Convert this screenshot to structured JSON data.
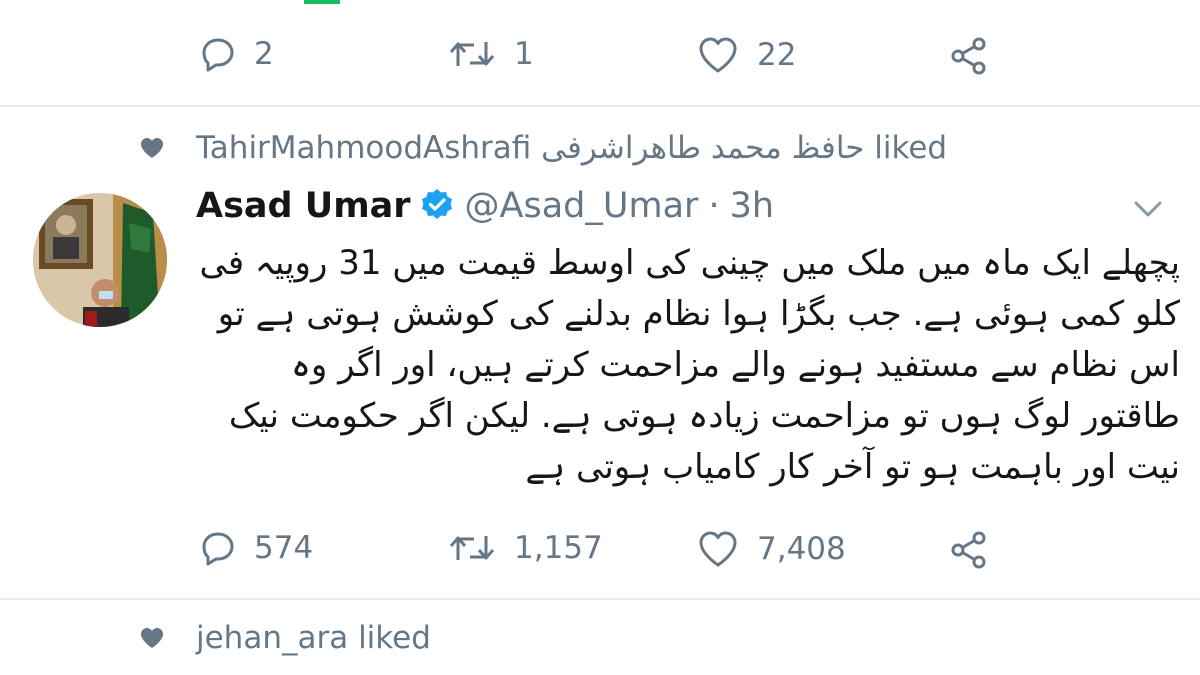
{
  "tweet1": {
    "actions": {
      "replies": "2",
      "retweets": "1",
      "likes": "22"
    }
  },
  "context1": {
    "text": "TahirMahmoodAshrafi حافظ محمد طاھراشرفی liked"
  },
  "tweet2": {
    "author_name": "Asad Umar",
    "handle": "@Asad_Umar",
    "separator": "·",
    "time": "3h",
    "text": "پچھلے ایک ماہ میں ملک میں چینی کی اوسط قیمت میں 31 روپیہ فی کلو کمی ہوئی ہے. جب بگڑا ہوا نظام بدلنے کی کوشش ہوتی ہے تو اس نظام سے مستفید ہونے والے مزاحمت کرتے ہیں، اور اگر وہ طاقتور لوگ ہوں تو مزاحمت زیادہ ہوتی ہے. لیکن اگر حکومت نیک نیت اور باہمت ہو تو آخر کار کامیاب ہوتی ہے",
    "actions": {
      "replies": "574",
      "retweets": "1,157",
      "likes": "7,408"
    }
  },
  "context2": {
    "text": "jehan_ara liked"
  },
  "colors": {
    "accent": "#1da1f2",
    "muted": "#657786",
    "divider": "#e6ecf0"
  },
  "icons": {
    "reply": "reply-icon",
    "retweet": "retweet-icon",
    "like": "heart-icon",
    "share": "share-icon",
    "verified": "verified-badge-icon",
    "more": "chevron-down-icon"
  }
}
